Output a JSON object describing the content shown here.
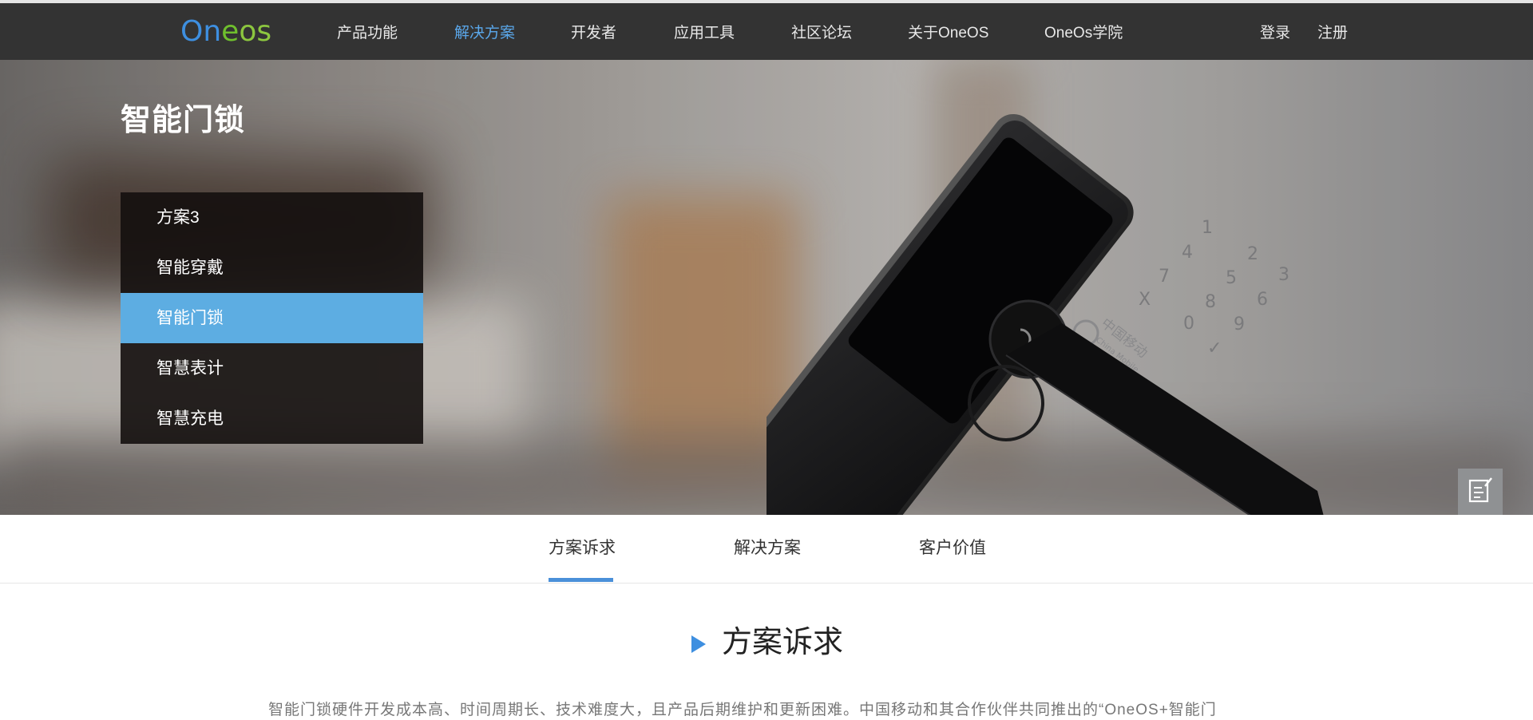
{
  "header": {
    "logo_text": "Oneos",
    "nav": [
      {
        "label": "产品功能",
        "active": false
      },
      {
        "label": "解决方案",
        "active": true
      },
      {
        "label": "开发者",
        "active": false
      },
      {
        "label": "应用工具",
        "active": false
      },
      {
        "label": "社区论坛",
        "active": false
      },
      {
        "label": "关于OneOS",
        "active": false
      },
      {
        "label": "OneOs学院",
        "active": false
      }
    ],
    "login": "登录",
    "register": "注册"
  },
  "banner": {
    "title": "智能门锁",
    "menu": [
      {
        "label": "方案3",
        "active": false
      },
      {
        "label": "智能穿戴",
        "active": false
      },
      {
        "label": "智能门锁",
        "active": true
      },
      {
        "label": "智慧表计",
        "active": false
      },
      {
        "label": "智慧充电",
        "active": false
      }
    ],
    "lock": {
      "keypad": [
        "1",
        "2",
        "3",
        "4",
        "5",
        "6",
        "7",
        "8",
        "9",
        "X",
        "0",
        "✓"
      ],
      "brand_cn": "中国移动",
      "brand_en": "China Mobile"
    }
  },
  "float_panel": {
    "icons": [
      "feedback-edit-icon",
      "add-user-icon"
    ]
  },
  "tabs": [
    {
      "label": "方案诉求",
      "active": true
    },
    {
      "label": "解决方案",
      "active": false
    },
    {
      "label": "客户价值",
      "active": false
    }
  ],
  "section": {
    "title": "方案诉求",
    "paragraph": "智能门锁硬件开发成本高、时间周期长、技术难度大，且产品后期维护和更新困难。中国移动和其合作伙伴共同推出的“OneOS+智能门"
  },
  "colors": {
    "header_bg": "#333333",
    "accent": "#5dade2",
    "tab_underline": "#4a90d9"
  }
}
